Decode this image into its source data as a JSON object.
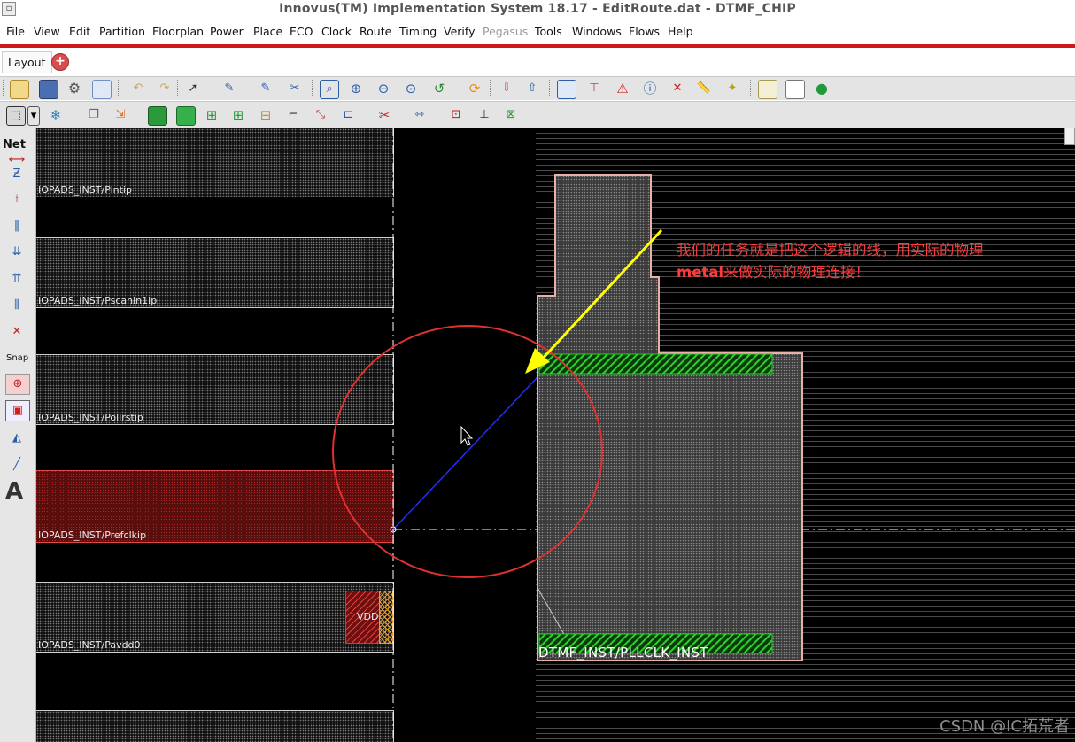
{
  "window": {
    "title": "Innovus(TM) Implementation System 18.17 - EditRoute.dat - DTMF_CHIP"
  },
  "menu": [
    {
      "label": "File",
      "enabled": true
    },
    {
      "label": "View",
      "enabled": true
    },
    {
      "label": "Edit",
      "enabled": true
    },
    {
      "label": "Partition",
      "enabled": true
    },
    {
      "label": "Floorplan",
      "enabled": true
    },
    {
      "label": "Power",
      "enabled": true
    },
    {
      "label": "Place",
      "enabled": true
    },
    {
      "label": "ECO",
      "enabled": true
    },
    {
      "label": "Clock",
      "enabled": true
    },
    {
      "label": "Route",
      "enabled": true
    },
    {
      "label": "Timing",
      "enabled": true
    },
    {
      "label": "Verify",
      "enabled": true
    },
    {
      "label": "Pegasus",
      "enabled": false
    },
    {
      "label": "Tools",
      "enabled": true
    },
    {
      "label": "Windows",
      "enabled": true
    },
    {
      "label": "Flows",
      "enabled": true
    },
    {
      "label": "Help",
      "enabled": true
    }
  ],
  "tabs": {
    "active": "Layout",
    "add_symbol": "+"
  },
  "left_toolbar": {
    "net_label": "Net",
    "snap_label": "Snap",
    "text_tool": "A"
  },
  "layout": {
    "pads": [
      {
        "name": "IOPADS_INST/Pintip",
        "highlighted": false
      },
      {
        "name": "IOPADS_INST/Pscanin1ip",
        "highlighted": false
      },
      {
        "name": "IOPADS_INST/Pollrstip",
        "highlighted": false
      },
      {
        "name": "IOPADS_INST/Prefclkip",
        "highlighted": true
      },
      {
        "name": "IOPADS_INST/Pavdd0",
        "highlighted": false
      }
    ],
    "vdd_label": "VDD",
    "macro_name": "DTMF_INST/PLLCLK_INST",
    "annotation_line1": "我们的任务就是把这个逻辑的线，用实际的物理",
    "annotation_line2_bold": "metal",
    "annotation_line2_rest": "来做实际的物理连接！",
    "colors": {
      "annotation": "#ff3b3b",
      "flightline": "#2a2aff",
      "arrow": "#ffff00",
      "circle": "#e03030",
      "pin_shape": "#22c022",
      "macro_outline": "#e8b0a8",
      "highlight_pad": "#e04848"
    }
  },
  "watermark": "CSDN @IC拓荒者"
}
